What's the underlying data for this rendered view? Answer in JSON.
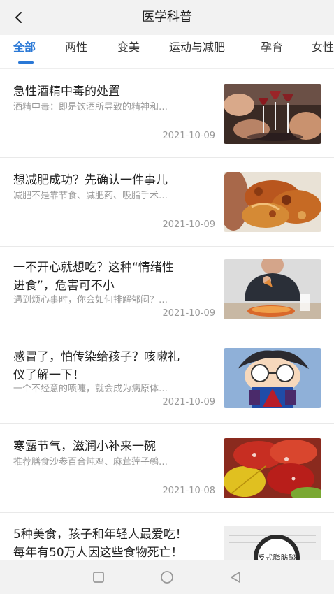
{
  "header": {
    "title": "医学科普"
  },
  "tabs": [
    {
      "label": "全部",
      "active": true
    },
    {
      "label": "两性"
    },
    {
      "label": "变美"
    },
    {
      "label": "运动与减肥"
    },
    {
      "label": "孕育"
    },
    {
      "label": "女性"
    }
  ],
  "articles": [
    {
      "title": "急性酒精中毒的处置",
      "summary": "酒精中毒：即是饮酒所导致的精神和…",
      "date": "2021-10-09",
      "image": "wine-toast-image"
    },
    {
      "title": "想减肥成功？先确认一件事儿",
      "summary": "减肥不是靠节食、减肥药、吸脂手术…",
      "date": "2021-10-09",
      "image": "fried-food-image"
    },
    {
      "title_line1": "一不开心就想吃？这种“情绪性",
      "title_line2": "进食”，危害可不小",
      "summary": "遇到烦心事时，你会如何排解郁闷？…",
      "date": "2021-10-09",
      "image": "man-eating-image"
    },
    {
      "title_line1": "感冒了，怕传染给孩子？咳嗽礼",
      "title_line2": "仪了解一下！",
      "summary": "一个不经意的喷嚏，就会成为病原体…",
      "date": "2021-10-09",
      "image": "cartoon-boy-image"
    },
    {
      "title": "寒露节气，滋润小补来一碗",
      "summary": "推荐膳食沙参百合炖鸡、麻茸莲子鹌…",
      "date": "2021-10-08",
      "image": "autumn-leaves-image"
    },
    {
      "title_line1": "5种美食，孩子和年轻人最爱吃！",
      "title_line2": "每年有50万人因这些食物死亡！",
      "image": "magnifier-image",
      "image_text": "反式脂肪酸"
    }
  ],
  "colors": {
    "accent": "#2a78d6",
    "muted": "#999999",
    "header_bg": "#f2f2f2"
  }
}
